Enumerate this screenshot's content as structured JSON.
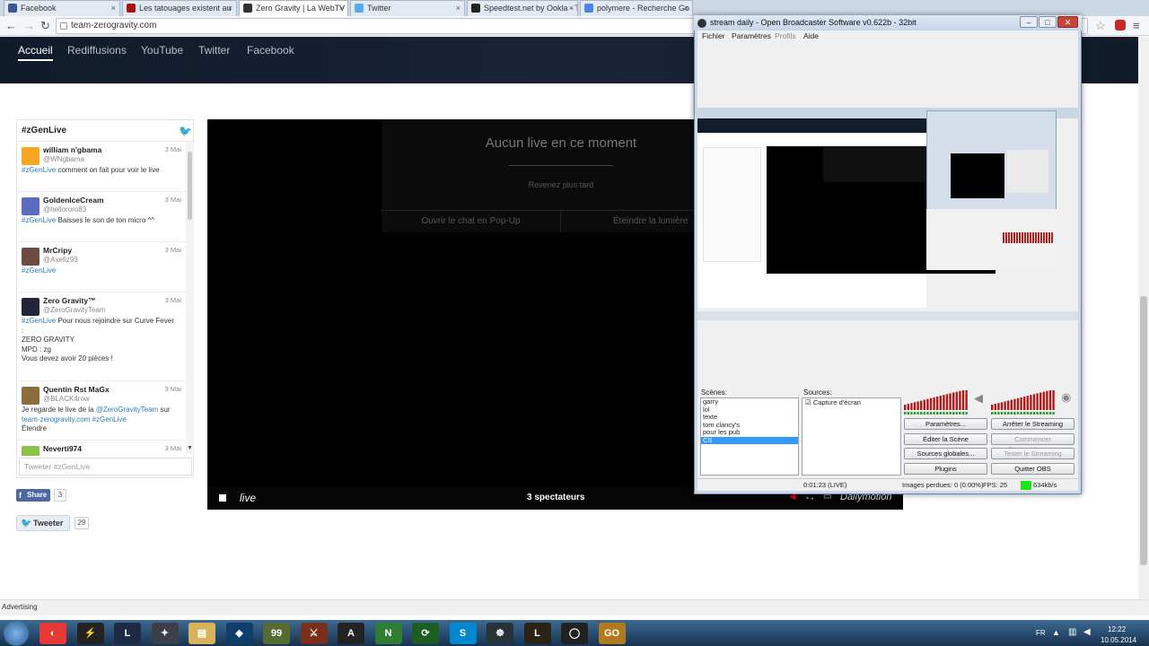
{
  "tabs": [
    {
      "label": "Facebook",
      "color": "#3b5998"
    },
    {
      "label": "Les tatouages existent au",
      "color": "#a11"
    },
    {
      "label": "Zero Gravity | La WebTV p",
      "color": "#333"
    },
    {
      "label": "Twitter",
      "color": "#55acee"
    },
    {
      "label": "Speedtest.net by Ookla - T",
      "color": "#222"
    },
    {
      "label": "polymere - Recherche Go",
      "color": "#4a86e8"
    }
  ],
  "address": {
    "url": "team-zerogravity.com"
  },
  "site": {
    "nav": [
      "Accueil",
      "Rediffusions",
      "YouTube",
      "Twitter",
      "Facebook"
    ]
  },
  "widget": {
    "title": "#zGenLive",
    "input_placeholder": "Tweeter #zGenLive",
    "tweets": [
      {
        "name": "william n'gbama",
        "handle": "@WNgbama",
        "date": "3 Mai",
        "tag": "#zGenLive",
        "text": " comment on fait pour voir le live",
        "avatar": "#f5a623"
      },
      {
        "name": "GoldenIceCream",
        "handle": "@hellororo83",
        "date": "3 Mai",
        "tag": "#zGenLive",
        "text": " Baisses le son de ton micro ^^",
        "avatar": "#5c6bc0"
      },
      {
        "name": "MrCripy",
        "handle": "@Axefiz93",
        "date": "3 Mai",
        "tag": "#zGenLive",
        "text": "",
        "avatar": "#6d4c41"
      },
      {
        "name": "Zero Gravity™",
        "handle": "@ZeroGravityTeam",
        "date": "3 Mai",
        "tag": "#zGenLive",
        "text": " Pour nous rejoindre sur Curve Fever\n:\nZERO GRAVITY\nMPD : zg\nVous devez avoir 20 pièces !",
        "avatar": "#22243a"
      },
      {
        "name": "Quentin Rst MaGx",
        "handle": "@BLACK4row",
        "date": "3 Mai",
        "tag": "",
        "text": "Je regarde le live de la ",
        "avatar": "#8d6e3a",
        "mention": "@ZeroGravityTeam",
        "after": " sur",
        "link": "team-zerogravity.com",
        "tag2": " #zGenLive",
        "extra": "Étendre"
      },
      {
        "name": "Neverti974",
        "handle": "",
        "date": "3 Mai",
        "tag": "",
        "text": "",
        "avatar": "#8bc34a"
      }
    ]
  },
  "share": {
    "fb_label": "Share",
    "fb_count": "3",
    "tw_label": "Tweeter",
    "tw_count": "29"
  },
  "player": {
    "message": "Aucun live en ce moment",
    "sub": "Revenez plus tard",
    "btn_popup": "Ouvrir le chat en Pop-Up",
    "btn_light": "Éteindre la lumière",
    "live": "live",
    "viewers": "3 spectateurs",
    "brand": "Dailymotion"
  },
  "ad": {
    "label": "Advertising"
  },
  "taskbar": {
    "apps": [
      {
        "glyph": "◐",
        "color": "#e53935"
      },
      {
        "glyph": "⚡",
        "color": "#222"
      },
      {
        "glyph": "L",
        "color": "#1e2a44"
      },
      {
        "glyph": "✦",
        "color": "#3a3f4a"
      },
      {
        "glyph": "▤",
        "color": "#d7b35a"
      },
      {
        "glyph": "◆",
        "color": "#0d3d6b"
      },
      {
        "glyph": "99",
        "color": "#556b2f"
      },
      {
        "glyph": "⚔",
        "color": "#7a2f1b"
      },
      {
        "glyph": "A",
        "color": "#222"
      },
      {
        "glyph": "N",
        "color": "#2e7d32"
      },
      {
        "glyph": "⟳",
        "color": "#1b5e20"
      },
      {
        "glyph": "S",
        "color": "#0288d1"
      },
      {
        "glyph": "☸",
        "color": "#263238"
      },
      {
        "glyph": "L",
        "color": "#2a2416"
      },
      {
        "glyph": "◯",
        "color": "#212121"
      },
      {
        "glyph": "GO",
        "color": "#b07a1f"
      }
    ],
    "lang": "FR",
    "time": "12:22",
    "date": "10.05.2014"
  },
  "obs": {
    "title": "stream daily - Open Broadcaster Software v0.622b - 32bit",
    "menu": [
      "Fichier",
      "Paramètres",
      "Profils",
      "Aide"
    ],
    "scenes_label": "Scènes:",
    "sources_label": "Sources:",
    "scenes": [
      "garry",
      "lol",
      "texte",
      "tom clancy's",
      "pour les pub",
      "CS"
    ],
    "selected_scene": "CS",
    "sources": [
      "Capture d'écran"
    ],
    "buttons": [
      {
        "label": "Paramètres...",
        "enabled": true
      },
      {
        "label": "Arrêter le Streaming",
        "enabled": true
      },
      {
        "label": "Éditer la Scène",
        "enabled": true
      },
      {
        "label": "Commencer l'enregistrement",
        "enabled": false
      },
      {
        "label": "Sources globales...",
        "enabled": true
      },
      {
        "label": "Tester le Streaming",
        "enabled": false
      },
      {
        "label": "Plugins",
        "enabled": true
      },
      {
        "label": "Quitter OBS",
        "enabled": true
      }
    ],
    "status": {
      "time": "0:01:23 (LIVE)",
      "dropped": "Images perdues: 0 (0.00%)",
      "fps": "FPS: 25",
      "bitrate": "634kb/s"
    }
  }
}
